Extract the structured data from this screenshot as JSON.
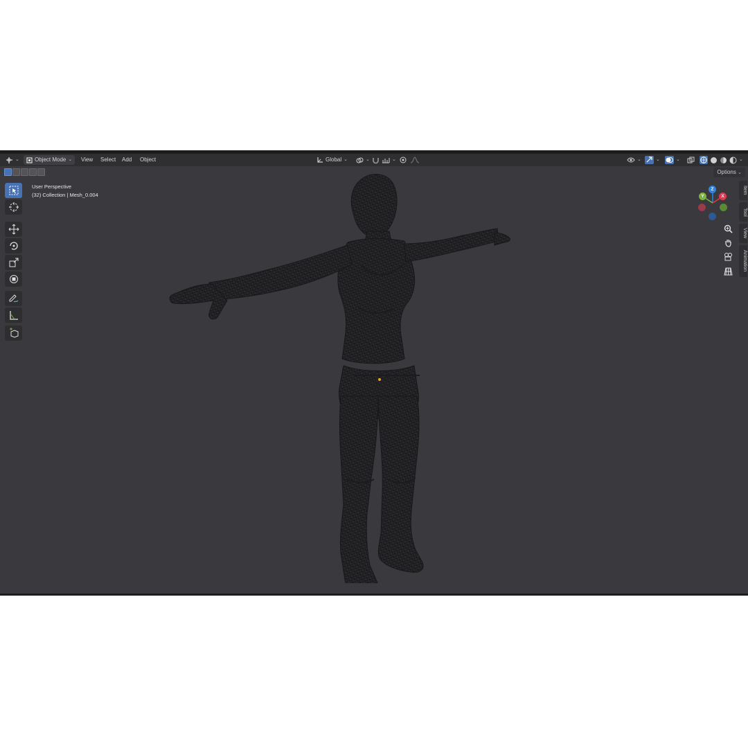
{
  "header": {
    "editor_icon": "editor-type-icon",
    "mode_label": "Object Mode",
    "menus": [
      "View",
      "Select",
      "Add",
      "Object"
    ],
    "transform_orientation": "Global"
  },
  "toolbar_header": {
    "options_label": "Options"
  },
  "viewport": {
    "view_label": "User Perspective",
    "collection_line": "(32) Collection | Mesh_0.004",
    "background": "#3a393d"
  },
  "tools": [
    "select-box-icon",
    "cursor-icon",
    "move-icon",
    "rotate-icon",
    "scale-icon",
    "transform-icon",
    "annotate-icon",
    "measure-icon",
    "add-cube-icon"
  ],
  "sidebar_tabs": [
    "Item",
    "Tool",
    "View",
    "Animation"
  ],
  "gizmo": {
    "z": "Z",
    "y": "Y",
    "x": "X",
    "colors": {
      "x": "#e2374f",
      "y": "#7ab63e",
      "z": "#2f84e3"
    }
  },
  "navigation": [
    "zoom-icon",
    "pan-hand-icon",
    "camera-icon",
    "perspective-grid-icon"
  ],
  "accent": "#4772b3"
}
